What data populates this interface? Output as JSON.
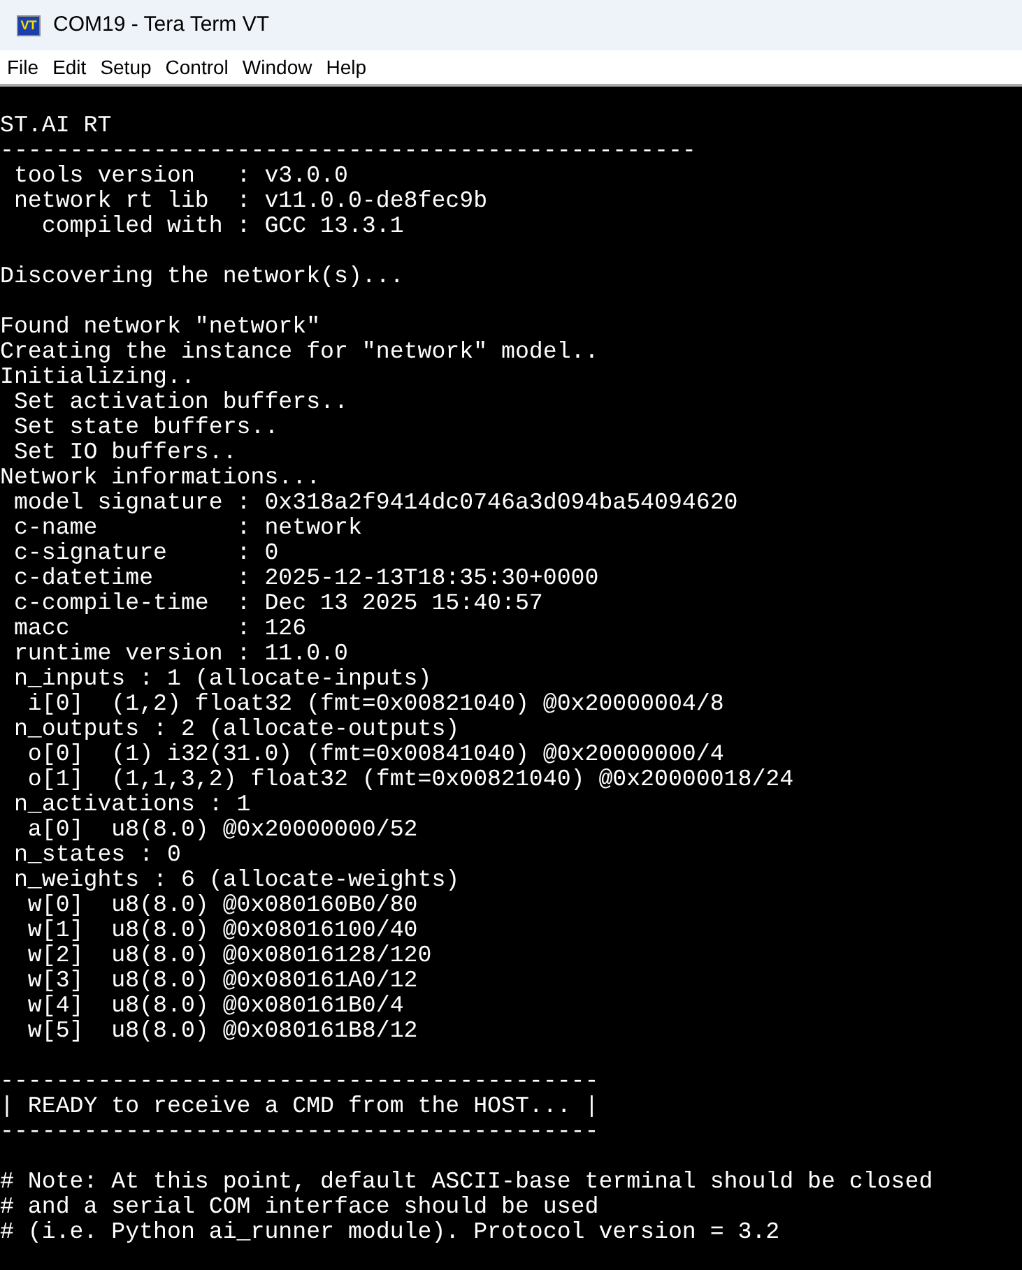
{
  "window": {
    "title": "COM19 - Tera Term VT",
    "icon_text": "VT"
  },
  "menu": [
    "File",
    "Edit",
    "Setup",
    "Control",
    "Window",
    "Help"
  ],
  "terminal": {
    "blocks": [
      [
        "ST.AI RT",
        "--------------------------------------------------",
        " tools version   : v3.0.0",
        " network rt lib  : v11.0.0-de8fec9b",
        "   compiled with : GCC 13.3.1"
      ],
      [
        "Discovering the network(s)..."
      ],
      [
        "Found network \"network\"",
        "Creating the instance for \"network\" model..",
        "Initializing..",
        " Set activation buffers..",
        " Set state buffers..",
        " Set IO buffers..",
        "Network informations...",
        " model signature : 0x318a2f9414dc0746a3d094ba54094620",
        " c-name          : network",
        " c-signature     : 0",
        " c-datetime      : 2025-12-13T18:35:30+0000",
        " c-compile-time  : Dec 13 2025 15:40:57",
        " macc            : 126",
        " runtime version : 11.0.0",
        " n_inputs : 1 (allocate-inputs)",
        "  i[0]  (1,2) float32 (fmt=0x00821040) @0x20000004/8",
        " n_outputs : 2 (allocate-outputs)",
        "  o[0]  (1) i32(31.0) (fmt=0x00841040) @0x20000000/4",
        "  o[1]  (1,1,3,2) float32 (fmt=0x00821040) @0x20000018/24",
        " n_activations : 1",
        "  a[0]  u8(8.0) @0x20000000/52",
        " n_states : 0",
        " n_weights : 6 (allocate-weights)",
        "  w[0]  u8(8.0) @0x080160B0/80",
        "  w[1]  u8(8.0) @0x08016100/40",
        "  w[2]  u8(8.0) @0x08016128/120",
        "  w[3]  u8(8.0) @0x080161A0/12",
        "  w[4]  u8(8.0) @0x080161B0/4",
        "  w[5]  u8(8.0) @0x080161B8/12"
      ],
      [
        "-------------------------------------------",
        "| READY to receive a CMD from the HOST... |",
        "-------------------------------------------"
      ],
      [
        "# Note: At this point, default ASCII-base terminal should be closed",
        "# and a serial COM interface should be used",
        "# (i.e. Python ai_runner module). Protocol version = 3.2"
      ]
    ]
  }
}
